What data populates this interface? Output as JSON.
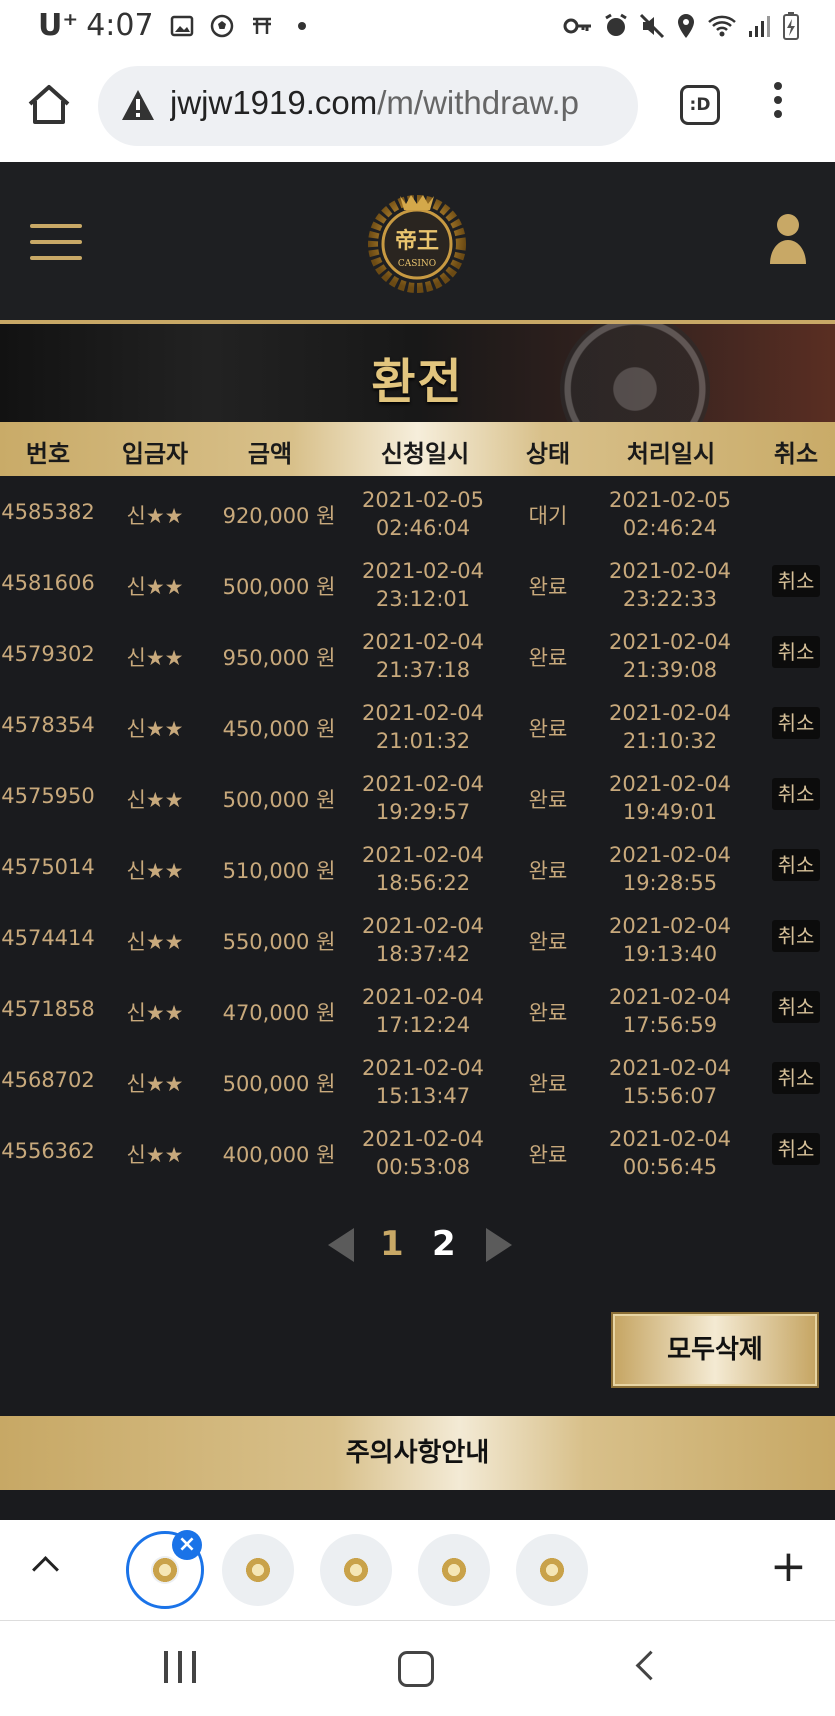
{
  "statusbar": {
    "carrier": "U⁺",
    "time": "4:07"
  },
  "browser": {
    "url_host": "jwjw1919.com",
    "url_path": "/m/withdraw.p",
    "tab_icon": ":D"
  },
  "site": {
    "logo_text": "CASINO",
    "page_title": "환전"
  },
  "table": {
    "headers": [
      "번호",
      "입금자",
      "금액",
      "신청일시",
      "상태",
      "처리일시",
      "취소"
    ],
    "rows": [
      {
        "no": "4585382",
        "depositor": "신★★",
        "amount": "920,000 원",
        "req_date": "2021-02-05",
        "req_time": "02:46:04",
        "status": "대기",
        "proc_date": "2021-02-05",
        "proc_time": "02:46:24",
        "cancel": ""
      },
      {
        "no": "4581606",
        "depositor": "신★★",
        "amount": "500,000 원",
        "req_date": "2021-02-04",
        "req_time": "23:12:01",
        "status": "완료",
        "proc_date": "2021-02-04",
        "proc_time": "23:22:33",
        "cancel": "취소"
      },
      {
        "no": "4579302",
        "depositor": "신★★",
        "amount": "950,000 원",
        "req_date": "2021-02-04",
        "req_time": "21:37:18",
        "status": "완료",
        "proc_date": "2021-02-04",
        "proc_time": "21:39:08",
        "cancel": "취소"
      },
      {
        "no": "4578354",
        "depositor": "신★★",
        "amount": "450,000 원",
        "req_date": "2021-02-04",
        "req_time": "21:01:32",
        "status": "완료",
        "proc_date": "2021-02-04",
        "proc_time": "21:10:32",
        "cancel": "취소"
      },
      {
        "no": "4575950",
        "depositor": "신★★",
        "amount": "500,000 원",
        "req_date": "2021-02-04",
        "req_time": "19:29:57",
        "status": "완료",
        "proc_date": "2021-02-04",
        "proc_time": "19:49:01",
        "cancel": "취소"
      },
      {
        "no": "4575014",
        "depositor": "신★★",
        "amount": "510,000 원",
        "req_date": "2021-02-04",
        "req_time": "18:56:22",
        "status": "완료",
        "proc_date": "2021-02-04",
        "proc_time": "19:28:55",
        "cancel": "취소"
      },
      {
        "no": "4574414",
        "depositor": "신★★",
        "amount": "550,000 원",
        "req_date": "2021-02-04",
        "req_time": "18:37:42",
        "status": "완료",
        "proc_date": "2021-02-04",
        "proc_time": "19:13:40",
        "cancel": "취소"
      },
      {
        "no": "4571858",
        "depositor": "신★★",
        "amount": "470,000 원",
        "req_date": "2021-02-04",
        "req_time": "17:12:24",
        "status": "완료",
        "proc_date": "2021-02-04",
        "proc_time": "17:56:59",
        "cancel": "취소"
      },
      {
        "no": "4568702",
        "depositor": "신★★",
        "amount": "500,000 원",
        "req_date": "2021-02-04",
        "req_time": "15:13:47",
        "status": "완료",
        "proc_date": "2021-02-04",
        "proc_time": "15:56:07",
        "cancel": "취소"
      },
      {
        "no": "4556362",
        "depositor": "신★★",
        "amount": "400,000 원",
        "req_date": "2021-02-04",
        "req_time": "00:53:08",
        "status": "완료",
        "proc_date": "2021-02-04",
        "proc_time": "00:56:45",
        "cancel": "취소"
      }
    ]
  },
  "pagination": {
    "pages": [
      "1",
      "2"
    ],
    "current": "1"
  },
  "actions": {
    "delete_all": "모두삭제"
  },
  "notice": {
    "label": "주의사항안내"
  },
  "colors": {
    "gold": "#c8a866",
    "dark_bg": "#1a1b1e",
    "text_gold": "#c8a97c",
    "tab_blue": "#1a73e8"
  }
}
